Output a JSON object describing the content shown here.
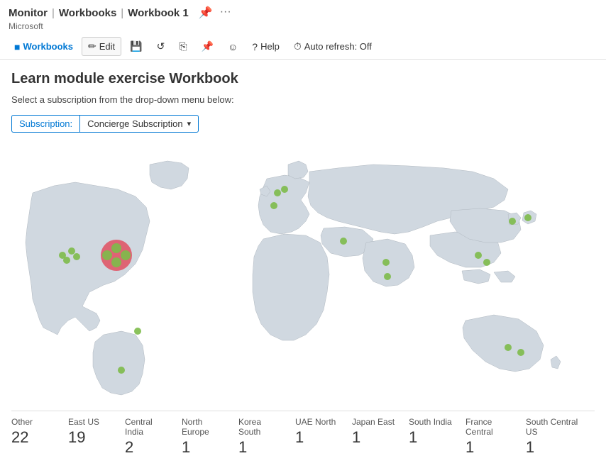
{
  "titleBar": {
    "app": "Monitor",
    "breadcrumb1": "Workbooks",
    "breadcrumb2": "Workbook 1",
    "company": "Microsoft"
  },
  "toolbar": {
    "workbooks_label": "Workbooks",
    "edit_label": "Edit",
    "help_label": "Help",
    "autorefresh_label": "Auto refresh: Off"
  },
  "page": {
    "title": "Learn module exercise Workbook",
    "subtitle": "Select a subscription from the drop-down menu below:"
  },
  "subscription": {
    "label": "Subscription:",
    "value": "Concierge Subscription",
    "dropdown_icon": "▾"
  },
  "stats": [
    {
      "label": "Other",
      "value": "22"
    },
    {
      "label": "East US",
      "value": "19"
    },
    {
      "label": "Central India",
      "value": "2"
    },
    {
      "label": "North Europe",
      "value": "1"
    },
    {
      "label": "Korea South",
      "value": "1"
    },
    {
      "label": "UAE North",
      "value": "1"
    },
    {
      "label": "Japan East",
      "value": "1"
    },
    {
      "label": "South India",
      "value": "1"
    },
    {
      "label": "France Central",
      "value": "1"
    },
    {
      "label": "South Central US",
      "value": "1"
    }
  ],
  "icons": {
    "pin": "📌",
    "ellipsis": "···",
    "edit": "✏",
    "save": "💾",
    "refresh": "↺",
    "clone": "⬤",
    "pushpin": "📌",
    "smiley": "☺",
    "question": "?",
    "clock": "⏱"
  }
}
